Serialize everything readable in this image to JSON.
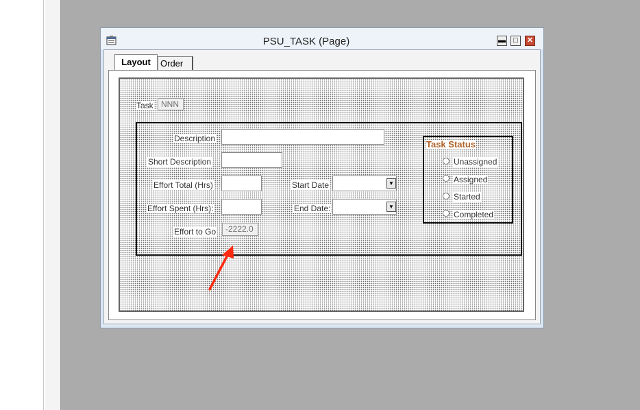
{
  "window": {
    "title": "PSU_TASK (Page)",
    "buttons": {
      "minimize": "▬",
      "maximize": "□",
      "close": "✕"
    }
  },
  "tabs": [
    {
      "label": "Layout",
      "active": true
    },
    {
      "label": "Order",
      "active": false
    }
  ],
  "form": {
    "task_label": "Task",
    "task_value": "NNN",
    "description_label": "Description",
    "short_description_label": "Short Description",
    "effort_total_label": "Effort Total (Hrs)",
    "effort_spent_label": "Effort Spent (Hrs):",
    "effort_to_go_label": "Effort to Go",
    "effort_to_go_value": "-2222.0",
    "start_date_label": "Start Date",
    "end_date_label": "End Date:",
    "dropdown_arrow": "▼"
  },
  "task_status": {
    "title": "Task Status",
    "title_color": "#b0632a",
    "options": [
      "Unassigned",
      "Assigned",
      "Started",
      "Completed"
    ]
  },
  "annotation": {
    "arrow_color": "#ff2a10"
  }
}
